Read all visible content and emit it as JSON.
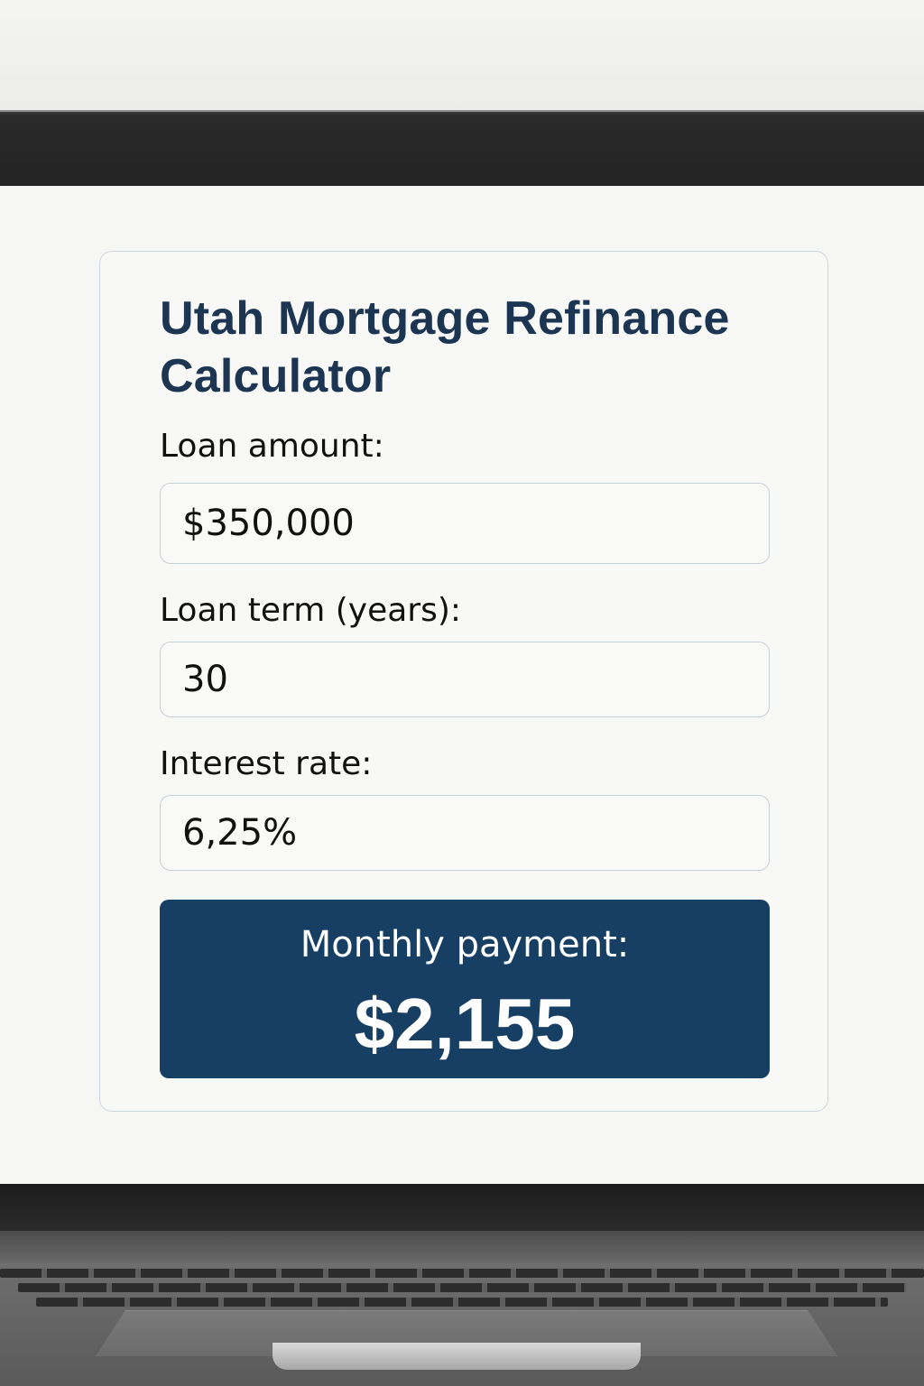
{
  "calculator": {
    "title": "Utah Mortgage Refinance Calculator",
    "fields": [
      {
        "label": "Loan amount:",
        "value": "$350,000"
      },
      {
        "label": "Loan term (years):",
        "value": "30"
      },
      {
        "label": "Interest rate:",
        "value": "6,25%"
      }
    ],
    "result": {
      "label": "Monthly payment:",
      "value": "$2,155"
    }
  },
  "colors": {
    "title": "#1b3552",
    "result_panel": "#173f64",
    "card_border": "#cfd6de"
  }
}
